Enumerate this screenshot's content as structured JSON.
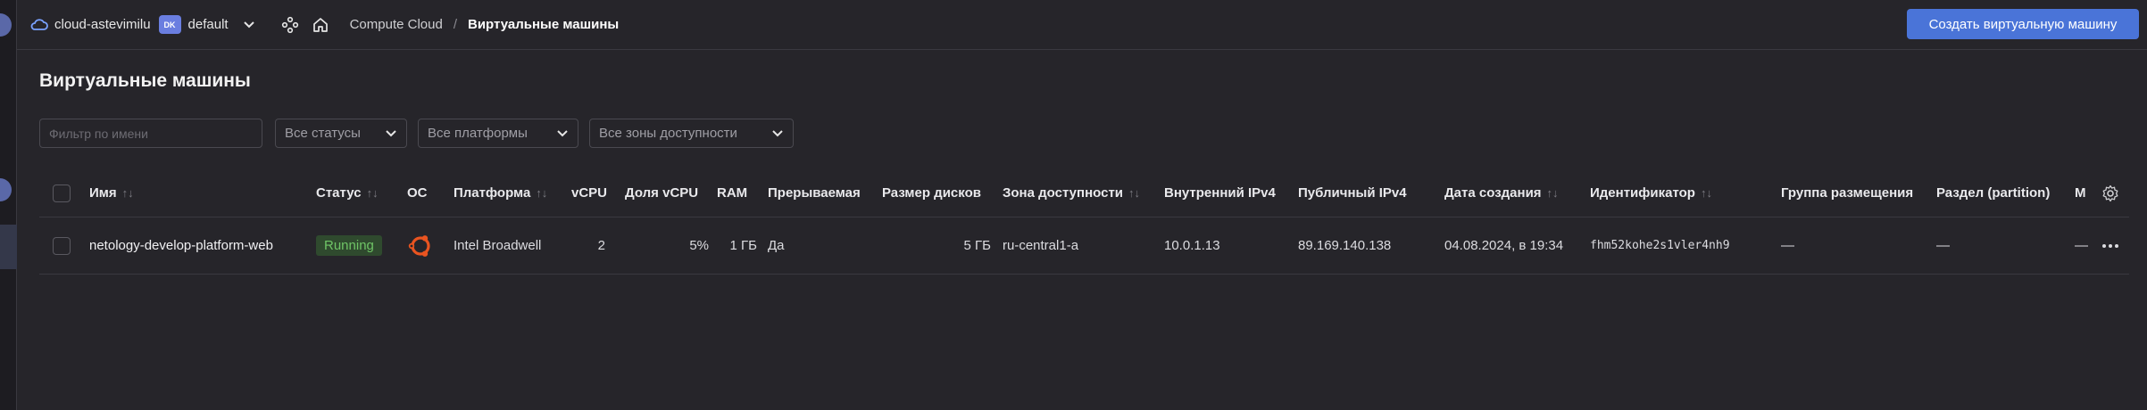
{
  "header": {
    "cloud_name": "cloud-astevimilu",
    "folder_badge": "DK",
    "folder_name": "default",
    "breadcrumb": [
      "Compute Cloud",
      "/"
    ],
    "current_page": "Виртуальные машины",
    "create_button": "Создать виртуальную машину",
    "accent_color": "#4a74d8"
  },
  "page_title": "Виртуальные машины",
  "filters": {
    "name_placeholder": "Фильтр по имени",
    "status": "Все статусы",
    "platform": "Все платформы",
    "zone": "Все зоны доступности"
  },
  "table": {
    "columns": {
      "name": "Имя",
      "status": "Статус",
      "os": "ОС",
      "platform": "Платформа",
      "vcpu": "vCPU",
      "vcpu_share": "Доля vCPU",
      "ram": "RAM",
      "preemptible": "Прерываемая",
      "disk_size": "Размер дисков",
      "zone": "Зона доступности",
      "internal_ip": "Внутренний IPv4",
      "public_ip": "Публичный IPv4",
      "created": "Дата создания",
      "id": "Идентификатор",
      "placement_group": "Группа размещения",
      "partition": "Раздел (partition)",
      "m": "М"
    },
    "rows": [
      {
        "name": "netology-develop-platform-web",
        "status": "Running",
        "os_icon": "ubuntu-icon",
        "platform": "Intel Broadwell",
        "vcpu": "2",
        "vcpu_share": "5%",
        "ram": "1 ГБ",
        "preemptible": "Да",
        "disk_size": "5 ГБ",
        "zone": "ru-central1-a",
        "internal_ip": "10.0.1.13",
        "public_ip": "89.169.140.138",
        "created": "04.08.2024, в 19:34",
        "id": "fhm52kohe2s1vler4nh9",
        "placement_group": "—",
        "partition": "—",
        "m": "—"
      }
    ]
  }
}
